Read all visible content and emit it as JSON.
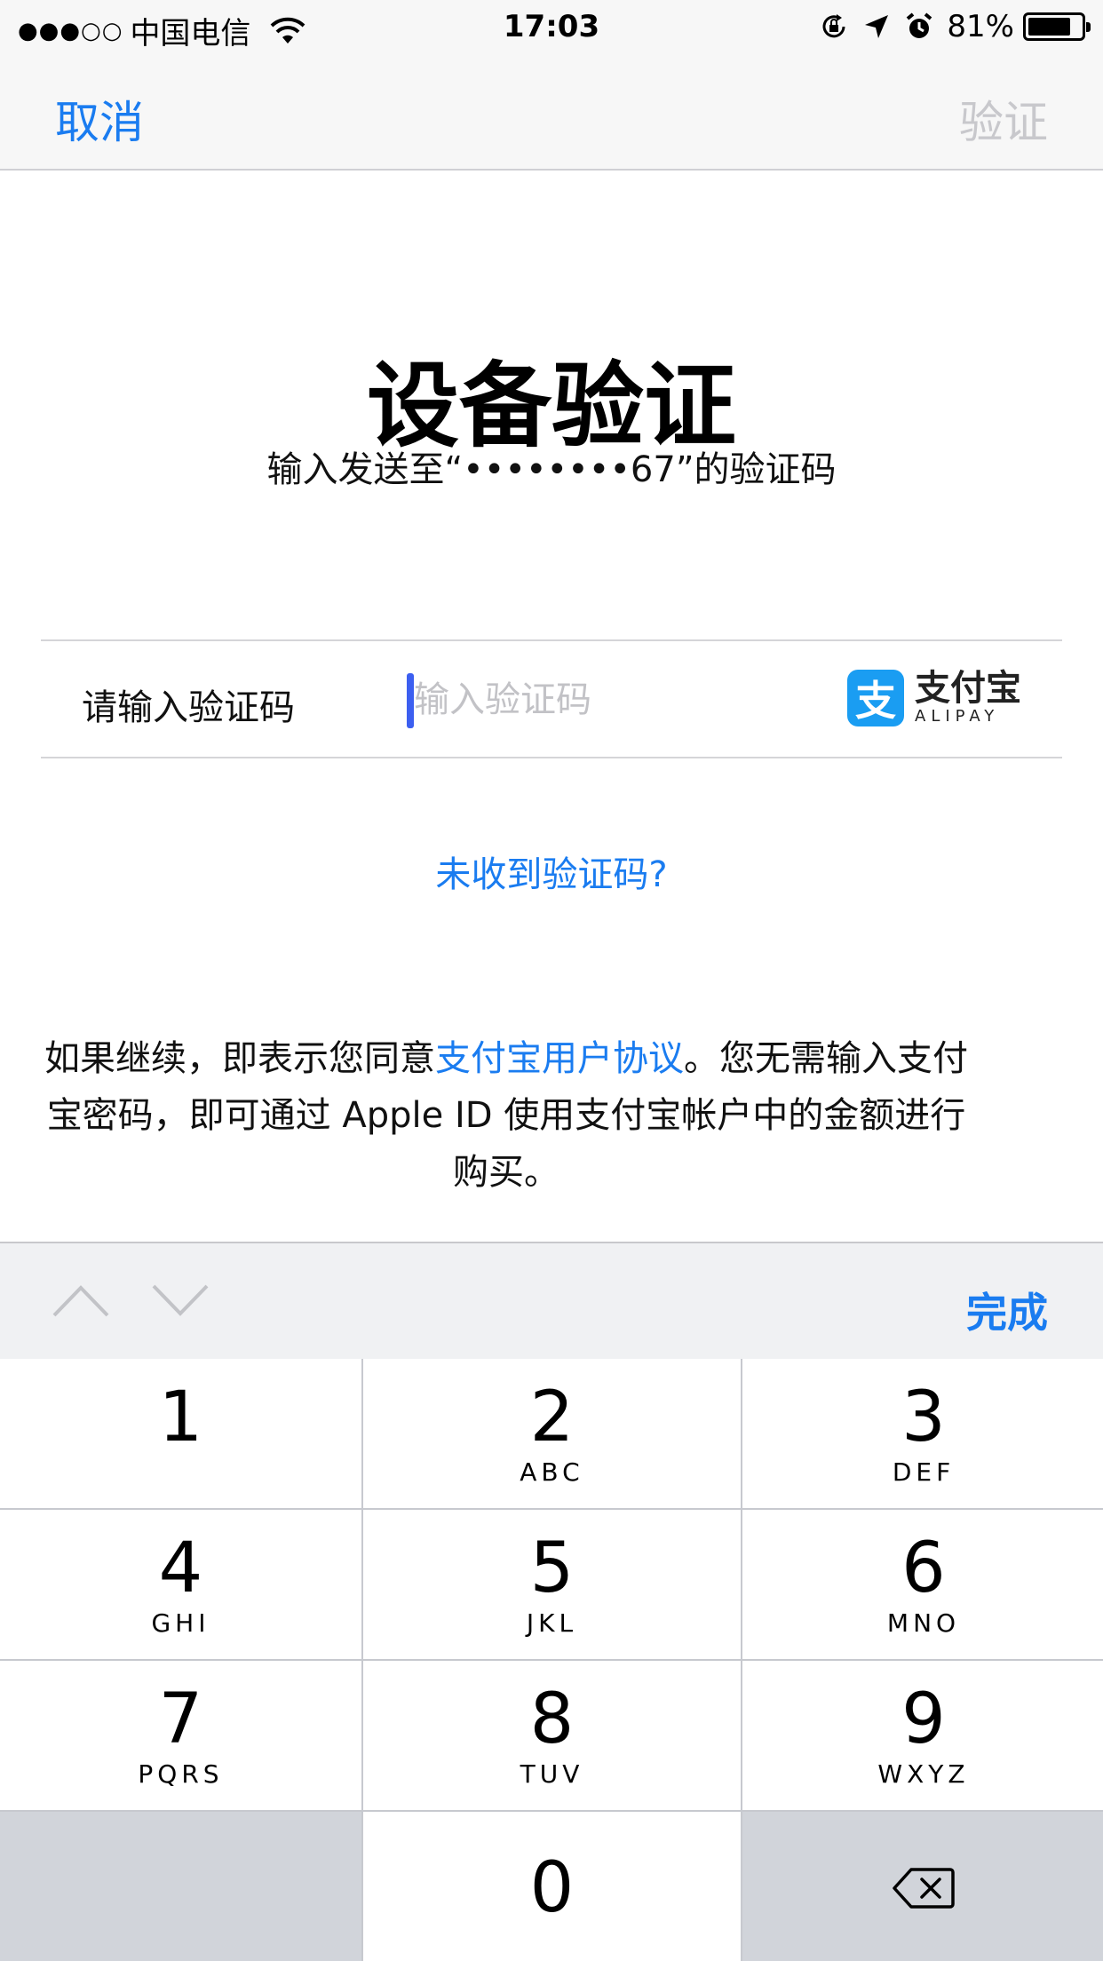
{
  "status_bar": {
    "signal": "●●●○○",
    "carrier": "中国电信",
    "time": "17:03",
    "battery_percent": "81%",
    "battery_level": 0.81,
    "icons": [
      "wifi-icon",
      "orientation-lock-icon",
      "location-arrow-icon",
      "alarm-icon",
      "battery-icon"
    ]
  },
  "nav": {
    "cancel_label": "取消",
    "verify_label": "验证"
  },
  "header": {
    "title": "设备验证",
    "subtitle": "输入发送至“••••••••67”的验证码"
  },
  "code_field": {
    "label": "请输入验证码",
    "value": "",
    "placeholder": "输入验证码",
    "brand_mark": "支",
    "brand_name": "支付宝",
    "brand_name_en": "ALIPAY"
  },
  "resend_link": "未收到验证码?",
  "agreement": {
    "prefix": "如果继续，即表示您同意",
    "link": "支付宝用户协议",
    "suffix": "。您无需输入支付宝密码，即可通过 Apple ID 使用支付宝帐户中的金额进行购买。"
  },
  "accessory": {
    "done_label": "完成",
    "icons": [
      "chevron-up-icon",
      "chevron-down-icon"
    ]
  },
  "keypad": {
    "keys": [
      {
        "digit": "1",
        "letters": ""
      },
      {
        "digit": "2",
        "letters": "ABC"
      },
      {
        "digit": "3",
        "letters": "DEF"
      },
      {
        "digit": "4",
        "letters": "GHI"
      },
      {
        "digit": "5",
        "letters": "JKL"
      },
      {
        "digit": "6",
        "letters": "MNO"
      },
      {
        "digit": "7",
        "letters": "PQRS"
      },
      {
        "digit": "8",
        "letters": "TUV"
      },
      {
        "digit": "9",
        "letters": "WXYZ"
      },
      {
        "digit": "0",
        "letters": ""
      }
    ]
  },
  "colors": {
    "accent": "#1a7cf0",
    "disabled": "#c8c8cc",
    "alipay_blue": "#1a9df2",
    "cursor": "#3c5ff0"
  }
}
